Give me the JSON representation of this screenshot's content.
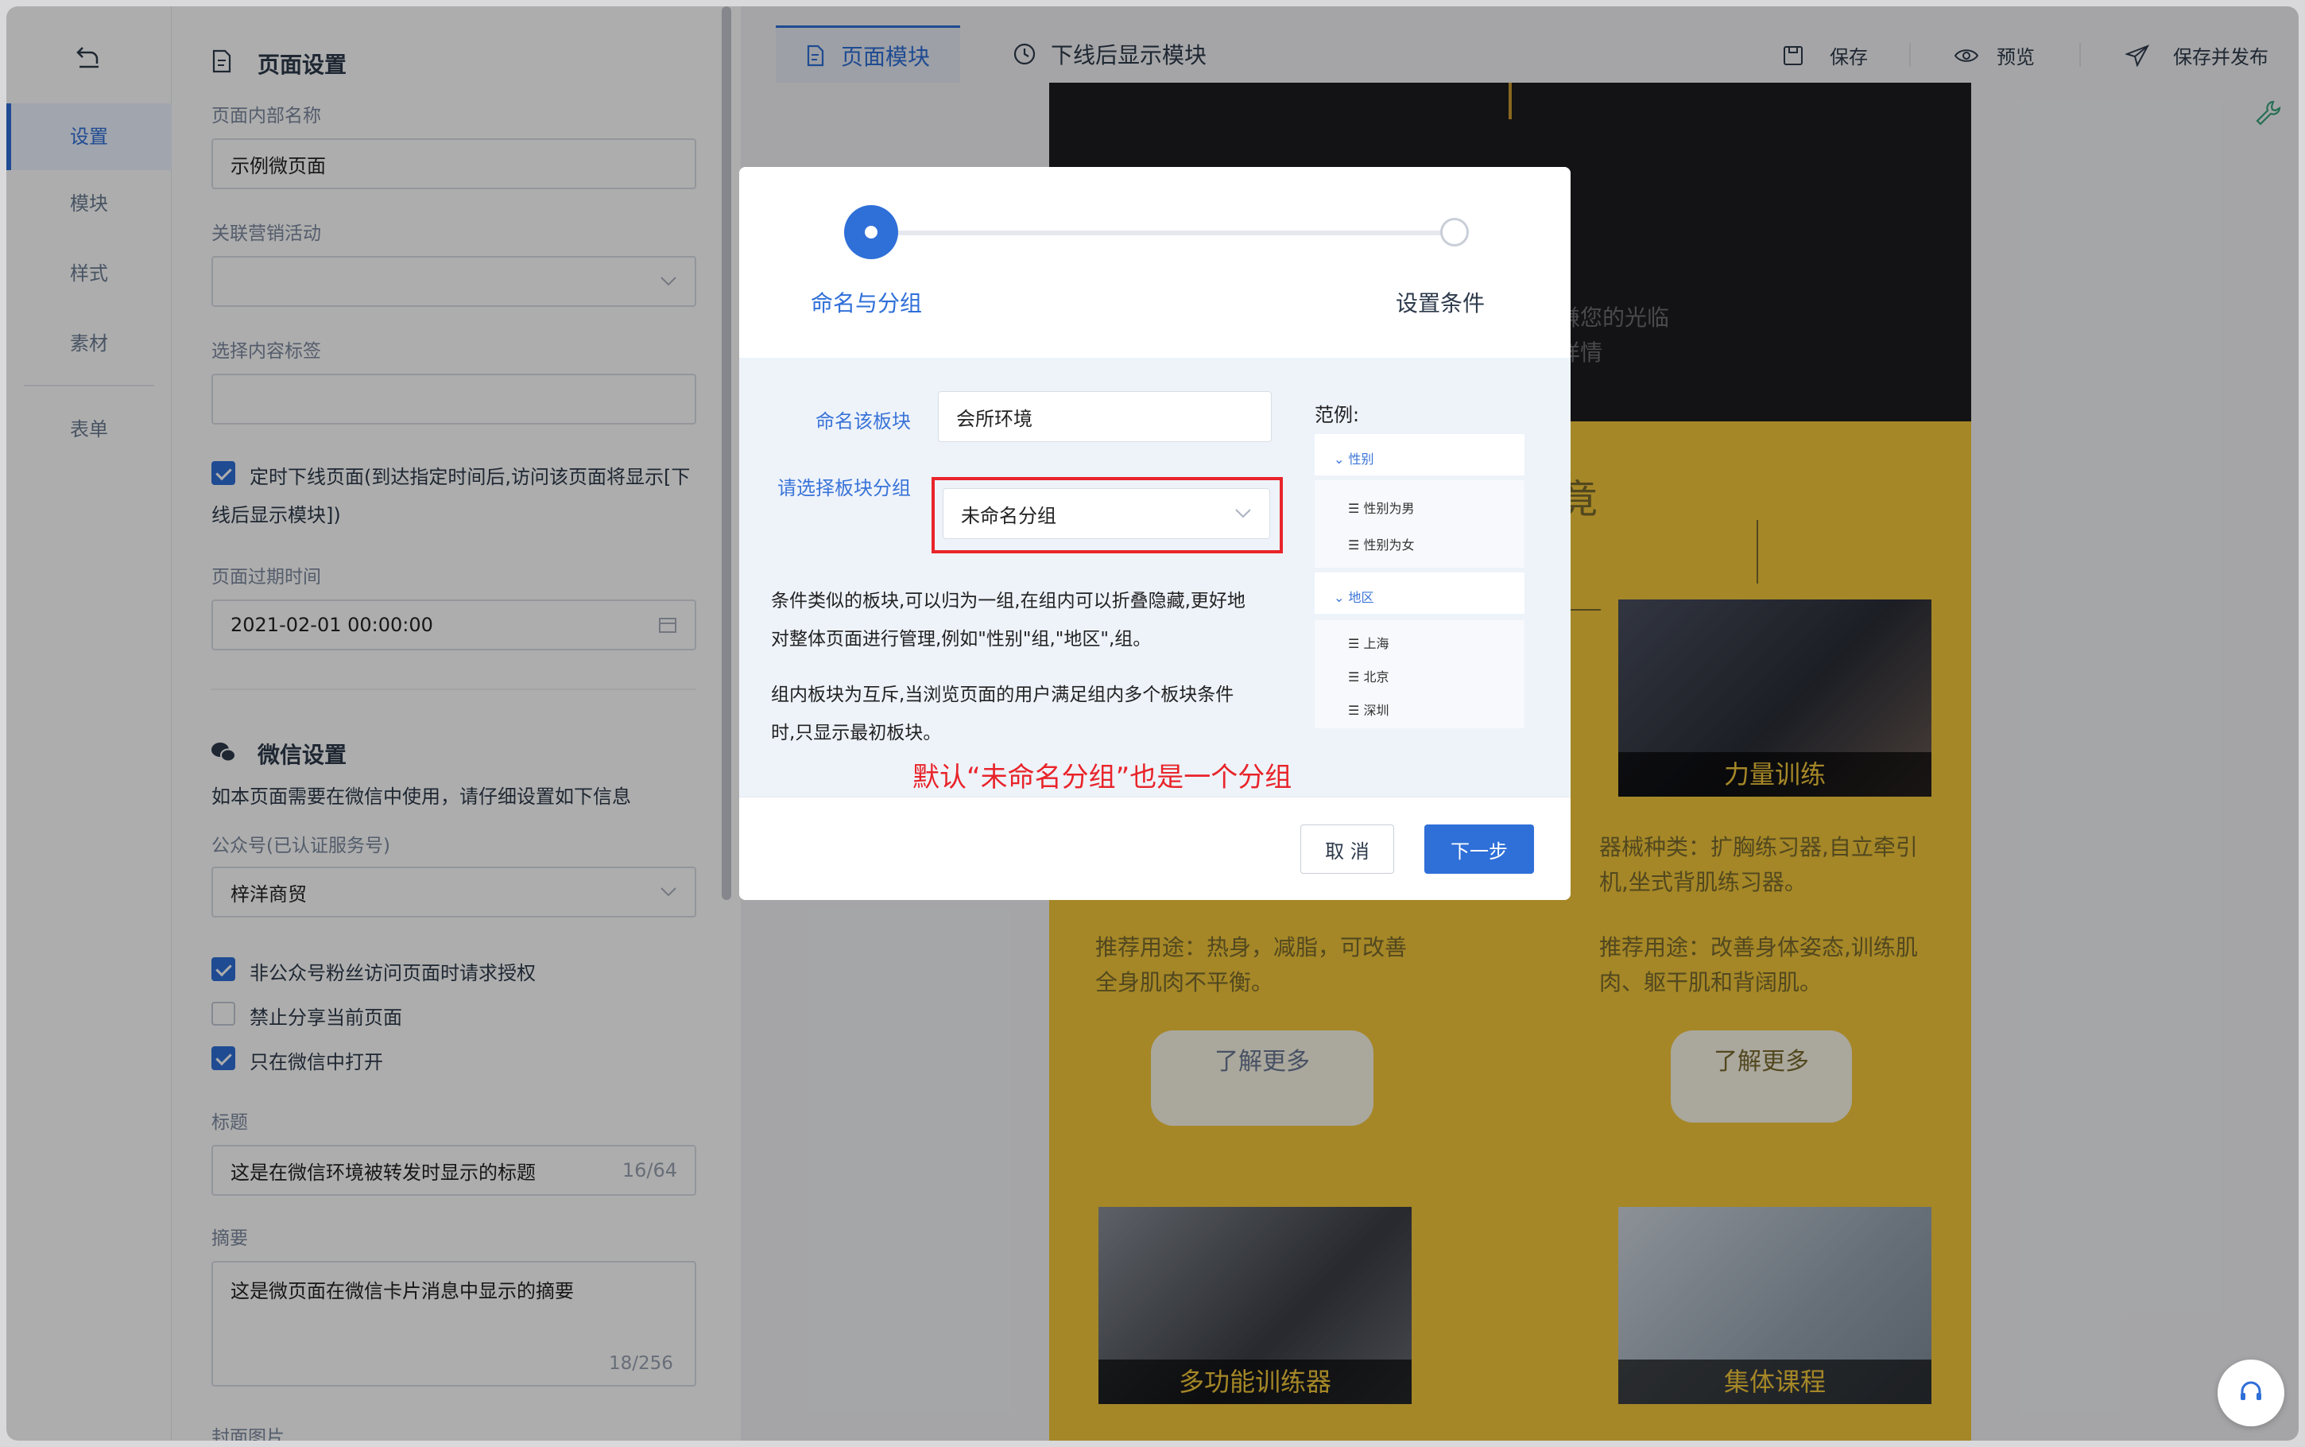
{
  "nav": {
    "items": [
      "设置",
      "模块",
      "样式",
      "素材",
      "表单"
    ],
    "active": "设置"
  },
  "settings": {
    "title": "页面设置",
    "internal_name_label": "页面内部名称",
    "internal_name_value": "示例微页面",
    "campaign_label": "关联营销活动",
    "tags_label": "选择内容标签",
    "offline_check_text_1": "定时下线页面(到达指定时间后,访问该页面将显示[下",
    "offline_check_text_2": "线后显示模块])",
    "expiry_label": "页面过期时间",
    "expiry_value": "2021-02-01 00:00:00",
    "wechat_title": "微信设置",
    "wechat_desc": "如本页面需要在微信中使用，请仔细设置如下信息",
    "account_label": "公众号(已认证服务号)",
    "account_value": "梓洋商贸",
    "check_auth": "非公众号粉丝访问页面时请求授权",
    "check_noshare": "禁止分享当前页面",
    "check_wechatonly": "只在微信中打开",
    "title_label": "标题",
    "title_value": "这是在微信环境被转发时显示的标题",
    "title_count": "16/64",
    "summary_label": "摘要",
    "summary_value": "这是微页面在微信卡片消息中显示的摘要",
    "summary_count": "18/256",
    "cover_label": "封面图片"
  },
  "topbar": {
    "tab_modules": "页面模块",
    "tab_offline": "下线后显示模块",
    "save": "保存",
    "preview": "预览",
    "save_publish": "保存并发布"
  },
  "preview": {
    "welcome": "谦您的光临",
    "details": "详情",
    "heading_partial": "竟",
    "card1_caption": "力量训练",
    "card1_desc_1": "器械种类：扩胸练习器,自立牵引",
    "card1_desc_2": "机,坐式背肌练习器。",
    "card1_use_1": "推荐用途：改善身体姿态,训练肌",
    "card1_use_2": "肉、躯干肌和背阔肌。",
    "left_use_1": "推荐用途：热身，减脂，可改善",
    "left_use_2": "全身肌肉不平衡。",
    "more_left": "了解更多",
    "more_right": "了解更多",
    "card2_caption": "多功能训练器",
    "card3_caption": "集体课程"
  },
  "modal": {
    "step1": "命名与分组",
    "step2": "设置条件",
    "name_label": "命名该板块",
    "name_value": "会所环境",
    "group_label": "请选择板块分组",
    "group_value": "未命名分组",
    "para1_1": "条件类似的板块,可以归为一组,在组内可以折叠隐藏,更好地",
    "para1_2": "对整体页面进行管理,例如\"性别\"组,\"地区\",组。",
    "para2_1": "组内板块为互斥,当浏览页面的用户满足组内多个板块条件",
    "para2_2": "时,只显示最初板块。",
    "annotation": "默认“未命名分组”也是一个分组",
    "example_title": "范例:",
    "example": {
      "g1": "性别",
      "g1_items": [
        "性别为男",
        "性别为女"
      ],
      "g2": "地区",
      "g2_items": [
        "上海",
        "北京",
        "深圳"
      ]
    },
    "cancel": "取 消",
    "next": "下一步"
  },
  "colors": {
    "accent": "#2f6fd8",
    "annotation": "#e8242a",
    "preview_bg": "#f3c73a"
  }
}
